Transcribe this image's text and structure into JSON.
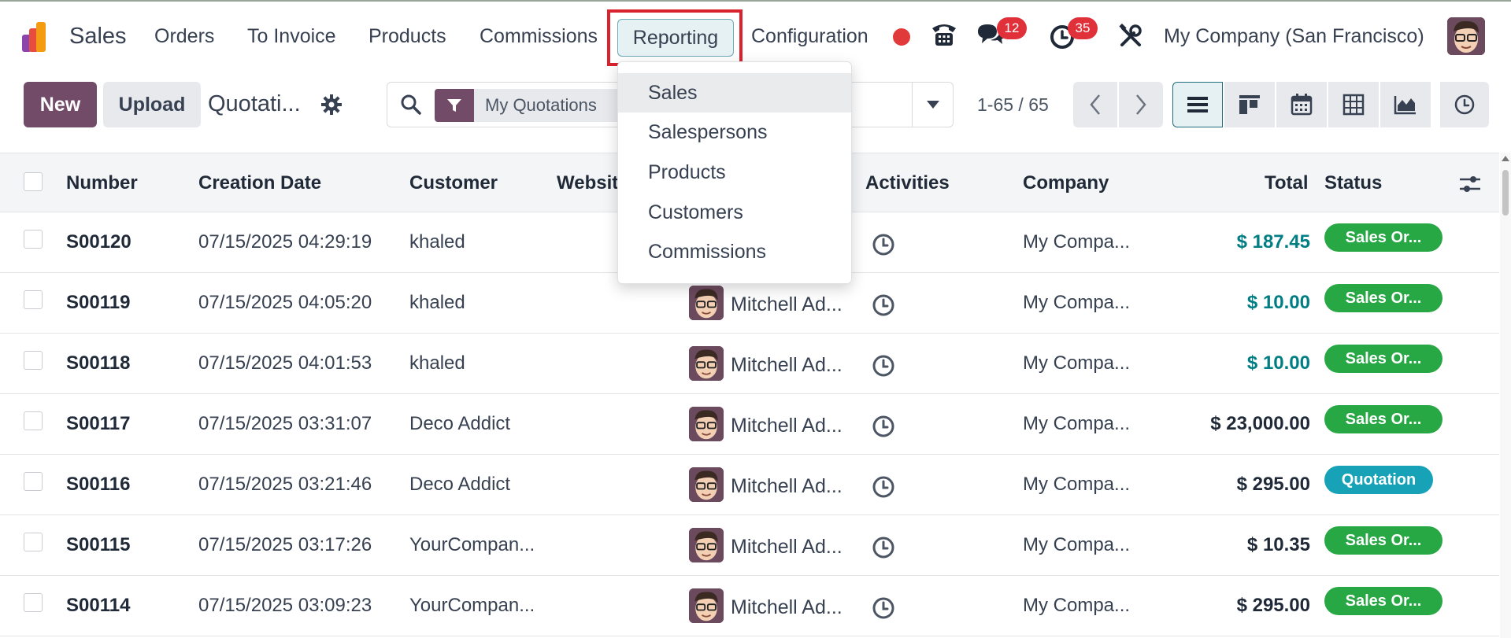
{
  "app": {
    "name": "Sales",
    "logo_icon": "odoo-sales-logo-icon"
  },
  "nav": {
    "items": [
      "Orders",
      "To Invoice",
      "Products",
      "Commissions",
      "Reporting",
      "Configuration"
    ],
    "active": "Reporting",
    "highlight_color": "#d9232e"
  },
  "systray": {
    "recording_color": "#e03a3a",
    "messages_count": "12",
    "activities_count": "35",
    "company": "My Company (San Francisco)"
  },
  "control": {
    "new_label": "New",
    "upload_label": "Upload",
    "breadcrumb": "Quotati...",
    "facet": "My Quotations",
    "pager": "1-65 / 65",
    "views": [
      "list-view-icon",
      "kanban-view-icon",
      "calendar-view-icon",
      "pivot-view-icon",
      "graph-view-icon",
      "activity-view-icon"
    ],
    "active_view": "list"
  },
  "table": {
    "columns": [
      "Number",
      "Creation Date",
      "Customer",
      "Websit",
      "Activities",
      "Company",
      "Total",
      "Status"
    ],
    "rows": [
      {
        "number": "S00120",
        "date": "07/15/2025 04:29:19",
        "customer": "khaled",
        "salesperson": "",
        "company": "My Compa...",
        "total": "$ 187.45",
        "status": "Sales Or...",
        "status_type": "sale",
        "total_style": "link"
      },
      {
        "number": "S00119",
        "date": "07/15/2025 04:05:20",
        "customer": "khaled",
        "salesperson": "Mitchell Ad...",
        "company": "My Compa...",
        "total": "$ 10.00",
        "status": "Sales Or...",
        "status_type": "sale",
        "total_style": "link"
      },
      {
        "number": "S00118",
        "date": "07/15/2025 04:01:53",
        "customer": "khaled",
        "salesperson": "Mitchell Ad...",
        "company": "My Compa...",
        "total": "$ 10.00",
        "status": "Sales Or...",
        "status_type": "sale",
        "total_style": "link"
      },
      {
        "number": "S00117",
        "date": "07/15/2025 03:31:07",
        "customer": "Deco Addict",
        "salesperson": "Mitchell Ad...",
        "company": "My Compa...",
        "total": "$ 23,000.00",
        "status": "Sales Or...",
        "status_type": "sale",
        "total_style": "plain"
      },
      {
        "number": "S00116",
        "date": "07/15/2025 03:21:46",
        "customer": "Deco Addict",
        "salesperson": "Mitchell Ad...",
        "company": "My Compa...",
        "total": "$ 295.00",
        "status": "Quotation",
        "status_type": "quotation",
        "total_style": "plain"
      },
      {
        "number": "S00115",
        "date": "07/15/2025 03:17:26",
        "customer": "YourCompan...",
        "salesperson": "Mitchell Ad...",
        "company": "My Compa...",
        "total": "$ 10.35",
        "status": "Sales Or...",
        "status_type": "sale",
        "total_style": "plain"
      },
      {
        "number": "S00114",
        "date": "07/15/2025 03:09:23",
        "customer": "YourCompan...",
        "salesperson": "Mitchell Ad...",
        "company": "My Compa...",
        "total": "$ 295.00",
        "status": "Sales Or...",
        "status_type": "sale",
        "total_style": "plain"
      }
    ],
    "colors": {
      "sale": "#28a745",
      "quotation": "#17a2b8",
      "link_total": "#017e84"
    }
  },
  "reporting_menu": {
    "items": [
      "Sales",
      "Salespersons",
      "Products",
      "Customers",
      "Commissions"
    ],
    "hovered": "Sales"
  }
}
